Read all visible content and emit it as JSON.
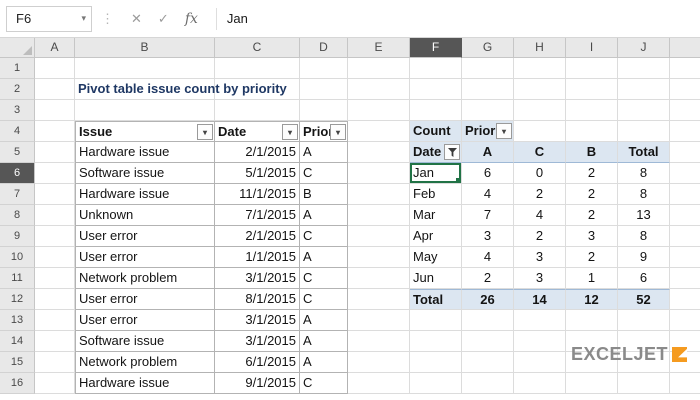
{
  "formula_bar": {
    "name_box": "F6",
    "cancel_icon": "✕",
    "enter_icon": "✓",
    "fx_icon": "fx",
    "formula": "Jan"
  },
  "icons": {
    "dropdown": "▾",
    "dots": "⋮"
  },
  "col_headers": [
    "A",
    "B",
    "C",
    "D",
    "E",
    "F",
    "G",
    "H",
    "I",
    "J"
  ],
  "row_headers": [
    "1",
    "2",
    "3",
    "4",
    "5",
    "6",
    "7",
    "8",
    "9",
    "10",
    "11",
    "12",
    "13",
    "14",
    "15",
    "16"
  ],
  "title": "Pivot table issue count by priority",
  "source_table": {
    "headers": [
      "Issue",
      "Date",
      "Priori"
    ],
    "rows": [
      [
        "Hardware issue",
        "2/1/2015",
        "A"
      ],
      [
        "Software issue",
        "5/1/2015",
        "C"
      ],
      [
        "Hardware issue",
        "11/1/2015",
        "B"
      ],
      [
        "Unknown",
        "7/1/2015",
        "A"
      ],
      [
        "User error",
        "2/1/2015",
        "C"
      ],
      [
        "User error",
        "1/1/2015",
        "A"
      ],
      [
        "Network problem",
        "3/1/2015",
        "C"
      ],
      [
        "User error",
        "8/1/2015",
        "C"
      ],
      [
        "User error",
        "3/1/2015",
        "A"
      ],
      [
        "Software issue",
        "3/1/2015",
        "A"
      ],
      [
        "Network problem",
        "6/1/2015",
        "A"
      ],
      [
        "Hardware issue",
        "9/1/2015",
        "C"
      ]
    ]
  },
  "pivot_table": {
    "count_label": "Count",
    "field_label": "Prior",
    "row_field": "Date",
    "column_headers": [
      "A",
      "C",
      "B",
      "Total"
    ],
    "rows": [
      {
        "label": "Jan",
        "values": [
          "6",
          "0",
          "2",
          "8"
        ]
      },
      {
        "label": "Feb",
        "values": [
          "4",
          "2",
          "2",
          "8"
        ]
      },
      {
        "label": "Mar",
        "values": [
          "7",
          "4",
          "2",
          "13"
        ]
      },
      {
        "label": "Apr",
        "values": [
          "3",
          "2",
          "3",
          "8"
        ]
      },
      {
        "label": "May",
        "values": [
          "4",
          "3",
          "2",
          "9"
        ]
      },
      {
        "label": "Jun",
        "values": [
          "2",
          "3",
          "1",
          "6"
        ]
      }
    ],
    "total_row": {
      "label": "Total",
      "values": [
        "26",
        "14",
        "12",
        "52"
      ]
    }
  },
  "selection": {
    "cell": "F6",
    "column": "F",
    "row": "6"
  },
  "logo": {
    "text": "EXCELJET"
  },
  "colors": {
    "accent_green": "#217346",
    "pivot_shade": "#DCE6F1",
    "title_navy": "#1F3864",
    "logo_orange": "#F59B20",
    "selected_header": "#565656"
  }
}
